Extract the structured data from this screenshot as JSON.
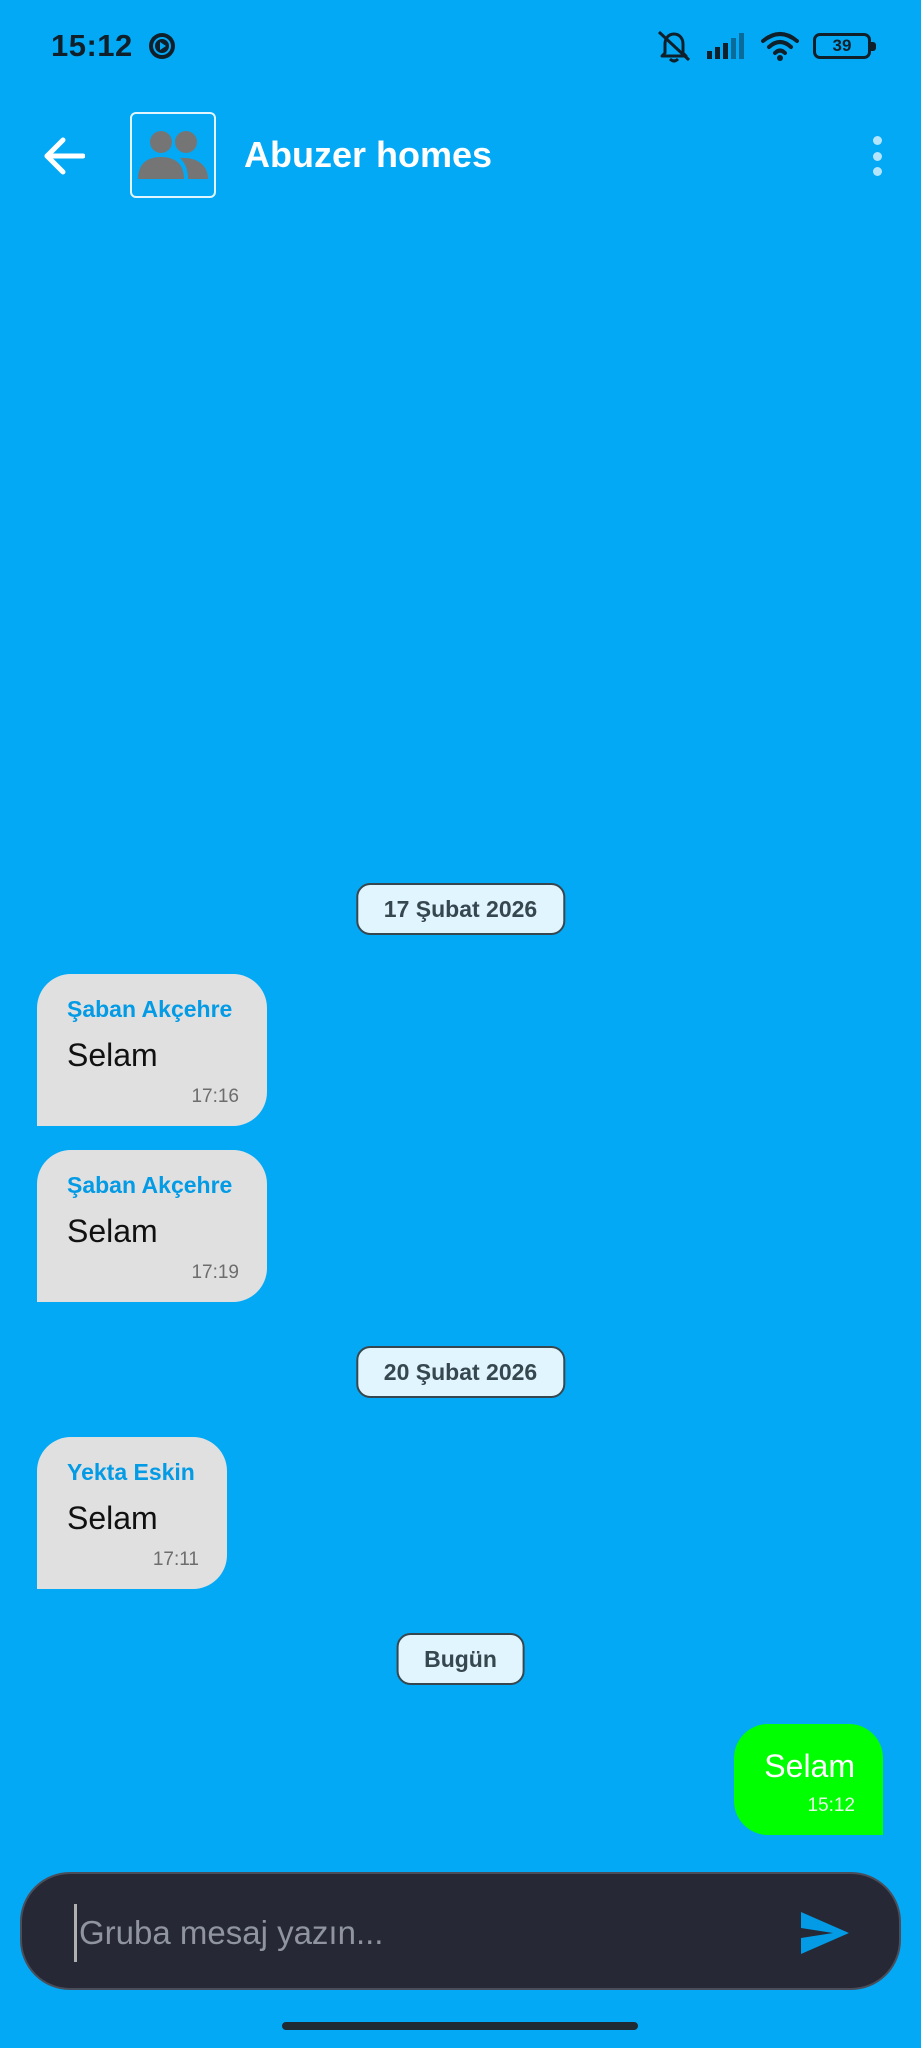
{
  "status_bar": {
    "time": "15:12",
    "battery_level": "39",
    "icons": [
      "media-playing-icon",
      "mute-icon",
      "signal-icon",
      "wifi-icon",
      "battery-icon"
    ]
  },
  "header": {
    "title": "Abuzer homes",
    "avatar_icon": "group-icon",
    "back_icon": "arrow-left-icon",
    "menu_icon": "more-vertical-icon"
  },
  "chat": {
    "date_chips": [
      "17 Şubat 2026",
      "20 Şubat 2026",
      "Bugün"
    ],
    "messages": [
      {
        "sender": "Şaban Akçehre",
        "text": "Selam",
        "time": "17:16"
      },
      {
        "sender": "Şaban Akçehre",
        "text": "Selam",
        "time": "17:19"
      },
      {
        "sender": "Yekta Eskin",
        "text": "Selam",
        "time": "17:11"
      }
    ],
    "outgoing": {
      "text": "Selam",
      "time": "15:12"
    }
  },
  "composer": {
    "value": "",
    "placeholder": "Gruba mesaj yazın...",
    "send_icon": "send-icon"
  },
  "colors": {
    "background": "#03A9F4",
    "incoming_bubble": "#E0E0E0",
    "outgoing_bubble": "#00FF00",
    "sender_name": "#039BE5",
    "composer": "#262835"
  }
}
